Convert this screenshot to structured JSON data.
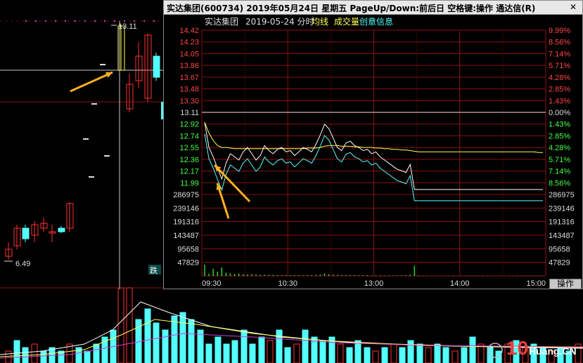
{
  "window": {
    "title": "实达集团(600734)  2019年05月24日  星期五  PageUp/Down:前后日  空格键:操作  通达信(R)",
    "close_label": "✕"
  },
  "chart_header": {
    "name": "实达集团",
    "date_label": "2019-05-24 分时",
    "avg_label": "均线",
    "vol_label": "成交量",
    "info_label": "创意信息"
  },
  "background": {
    "high_price": "13.11",
    "low_price": "6.49",
    "limit_down_badge": "跌"
  },
  "colors": {
    "up": "#ff3030",
    "down": "#54ffff",
    "avg": "#ffff55",
    "price_white": "#ffffff",
    "grid": "#8a1010",
    "arrow": "#ffb020",
    "text_price_up": "#ff4444",
    "text_price_down": "#44ff44"
  },
  "chart_data": {
    "type": "line",
    "prev_close": 13.11,
    "price_ticks": [
      "14.42",
      "14.23",
      "14.05",
      "13.86",
      "13.67",
      "13.48",
      "13.30",
      "13.11",
      "12.92",
      "12.74",
      "12.55",
      "12.36",
      "12.17",
      "11.99"
    ],
    "pct_ticks": [
      "9.99%",
      "8.56%",
      "7.14%",
      "5.71%",
      "4.28%",
      "2.85%",
      "1.43%",
      "0.00%",
      "1.43%",
      "2.85%",
      "4.28%",
      "5.71%",
      "7.14%",
      "8.56%"
    ],
    "vol_ticks": [
      "286975",
      "239146",
      "191316",
      "143487",
      "95658",
      "47829"
    ],
    "time_ticks": [
      "09:30",
      "10:30",
      "13:00",
      "14:00",
      "15:00"
    ],
    "ops_label": "操作",
    "price_series": [
      12.95,
      12.55,
      12.4,
      12.22,
      12.05,
      12.3,
      12.45,
      12.4,
      12.35,
      12.48,
      12.55,
      12.45,
      12.35,
      12.42,
      12.58,
      12.5,
      12.45,
      12.52,
      12.55,
      12.48,
      12.5,
      12.42,
      12.48,
      12.55,
      12.52,
      12.48,
      12.6,
      12.75,
      12.92,
      12.85,
      12.7,
      12.55,
      12.5,
      12.62,
      12.65,
      12.58,
      12.55,
      12.5,
      12.52,
      12.45,
      12.48,
      12.4,
      12.35,
      12.3,
      12.25,
      12.2,
      12.18,
      12.15,
      12.28,
      11.88,
      11.88,
      11.88,
      11.88,
      11.88,
      11.88,
      11.88,
      11.88,
      11.88,
      11.88,
      11.88,
      11.88,
      11.88,
      11.88,
      11.88,
      11.88,
      11.88,
      11.88,
      11.88,
      11.88,
      11.88,
      11.88,
      11.88,
      11.88,
      11.88,
      11.88,
      11.88,
      11.88,
      11.88,
      11.88,
      11.88
    ],
    "avg_series": [
      12.95,
      12.78,
      12.66,
      12.58,
      12.55,
      12.55,
      12.54,
      12.53,
      12.53,
      12.53,
      12.53,
      12.53,
      12.53,
      12.53,
      12.53,
      12.53,
      12.53,
      12.53,
      12.53,
      12.53,
      12.53,
      12.53,
      12.53,
      12.53,
      12.54,
      12.54,
      12.54,
      12.55,
      12.57,
      12.58,
      12.58,
      12.58,
      12.57,
      12.57,
      12.57,
      12.56,
      12.56,
      12.55,
      12.55,
      12.55,
      12.54,
      12.54,
      12.53,
      12.53,
      12.52,
      12.52,
      12.51,
      12.51,
      12.5,
      12.49,
      12.48,
      12.48,
      12.48,
      12.48,
      12.48,
      12.48,
      12.48,
      12.48,
      12.48,
      12.48,
      12.48,
      12.48,
      12.48,
      12.48,
      12.48,
      12.48,
      12.48,
      12.48,
      12.48,
      12.48,
      12.48,
      12.48,
      12.48,
      12.48,
      12.48,
      12.48,
      12.48,
      12.48,
      12.47,
      12.47
    ],
    "volume_series": [
      40000,
      8000,
      25000,
      15000,
      30000,
      12000,
      9000,
      7000,
      8000,
      6000,
      5000,
      6000,
      5000,
      4000,
      4000,
      4000,
      4000,
      3000,
      3000,
      3000,
      3000,
      3000,
      3000,
      2000,
      3000,
      3000,
      4000,
      5000,
      9000,
      6000,
      5000,
      4000,
      3000,
      3000,
      3000,
      3000,
      3000,
      3000,
      3000,
      2000,
      2000,
      2000,
      2000,
      2000,
      2000,
      2000,
      2000,
      3000,
      4000,
      36000,
      2000,
      1000,
      1000,
      1000,
      1000,
      1000,
      1000,
      1000,
      1000,
      1000,
      1000,
      1000,
      1000,
      1000,
      1000,
      1000,
      1000,
      1000,
      1000,
      1000,
      1000,
      1000,
      1000,
      1000,
      1000,
      1000,
      1000,
      1000,
      1000,
      1000
    ]
  }
}
